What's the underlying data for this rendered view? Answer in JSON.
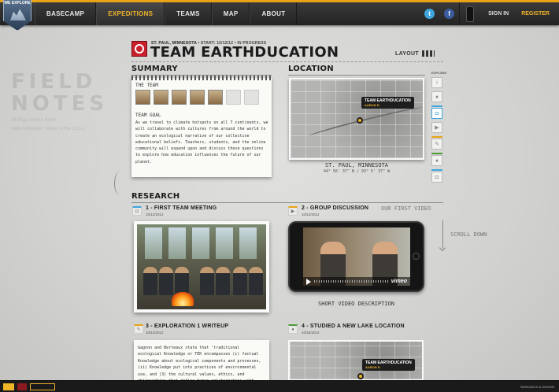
{
  "brand": {
    "logo_text": "WE EXPLORE"
  },
  "nav": {
    "items": [
      {
        "label": "BASECAMP",
        "active": false
      },
      {
        "label": "EXPEDITIONS",
        "active": true
      },
      {
        "label": "TEAMS",
        "active": false
      },
      {
        "label": "MAP",
        "active": false
      },
      {
        "label": "ABOUT",
        "active": false
      }
    ],
    "sign_in": "SIGN IN",
    "register": "REGISTER"
  },
  "background_notes": {
    "title": "FIELD NOTES",
    "sub1": "48-Page Memo Book",
    "sub2": "rable Materials / Made in the U.S.A."
  },
  "team": {
    "location": "ST. PAUL, MINNESOTA",
    "meta": "• START: 10/12/12 • IN PROGRESS",
    "title": "TEAM EARTHDUCATION"
  },
  "layout_label": "LAYOUT",
  "summary": {
    "heading": "SUMMARY",
    "team_label": "THE TEAM",
    "goal_label": "TEAM GOAL",
    "goal_text": "As we travel to climate hotspots on all 7 continents, we will collaborate with cultures from around the world to create an ecological narrative of our collective educational beliefs. Teachers, students, and the online community will expand upon and discuss these questions to explore how education influences the future of our planet."
  },
  "location": {
    "heading": "LOCATION",
    "callout_title": "TEAM EARTHDUCATION",
    "callout_sub": "AARON D.",
    "city": "ST. PAUL, MINNESOTA",
    "coords": "44° 56' 37\" N / 93° 5' 37\" W"
  },
  "explore": {
    "label": "EXPLORE"
  },
  "research": {
    "heading": "RESEARCH",
    "hint_video": "OUR FIRST VIDEO",
    "scroll_hint": "SCROLL DOWN",
    "cards": [
      {
        "title": "1 - FIRST TEAM MEETING",
        "date": "10/12/2012"
      },
      {
        "title": "2 - GROUP DISCUSSION",
        "date": "10/14/2012"
      },
      {
        "title": "3 - EXPLORATION 1 WRITEUP",
        "date": "10/14/2012"
      },
      {
        "title": "4 - STUDIED A NEW LAKE LOCATION",
        "date": "10/15/2012"
      }
    ],
    "video_brand": "vimeo",
    "video_caption": "SHORT VIDEO DESCRIPTION",
    "writeup_text": "Gagnon and Berteaux state that 'traditional ecological Knowledge or TEK encompasses (i) factual Knowledge about ecological components and processes, (ii) Knowledge put into practices of environmental use, and (3) the cultural values, ethics, and philosophies that define human relationships with",
    "map2_callout_title": "TEAM EARTHDUCATION",
    "map2_callout_sub": "AARON D."
  },
  "footer": {
    "credit": "RESEARCH & DESIGN"
  },
  "colors": {
    "accent": "#f0b429",
    "twitter": "#3fa6de",
    "facebook": "#3b5c9e",
    "brand_red": "#c8202b"
  }
}
